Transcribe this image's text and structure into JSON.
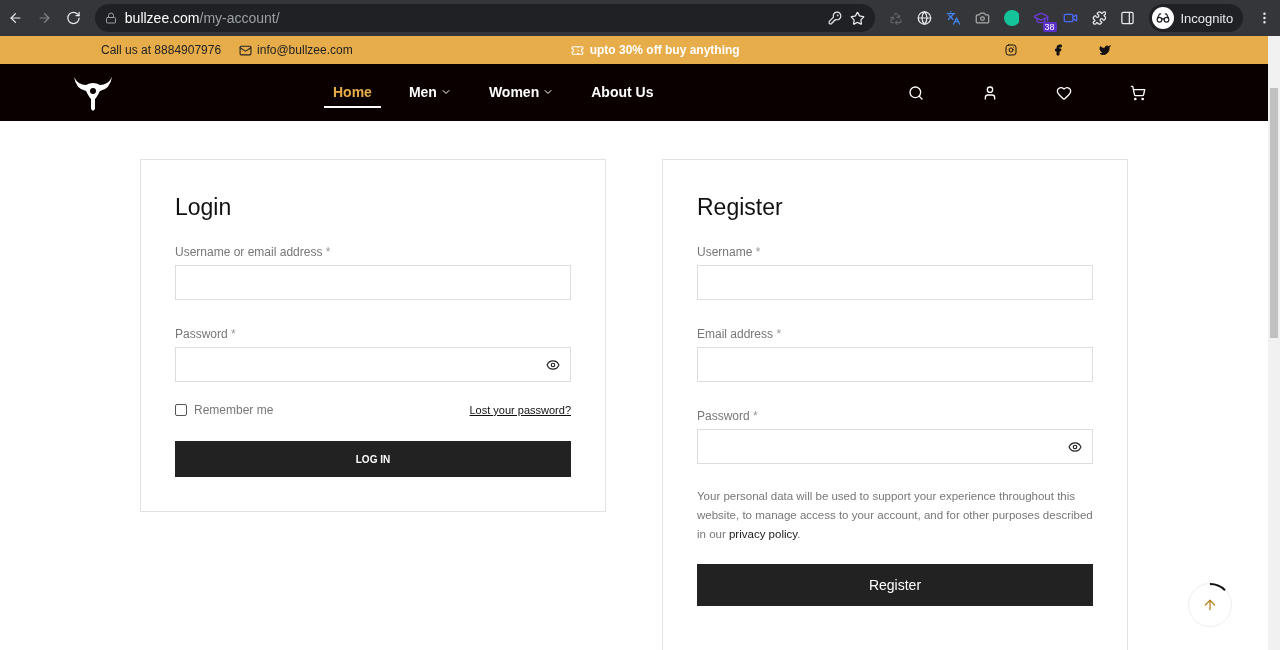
{
  "browser": {
    "url_host": "bullzee.com",
    "url_path": "/my-account/",
    "extension_badge": "38",
    "profile_label": "Incognito"
  },
  "topbar": {
    "phone": "Call us at 8884907976",
    "email": "info@bullzee.com",
    "promo": "upto 30% off buy anything"
  },
  "nav": {
    "items": [
      {
        "label": "Home",
        "selected": true,
        "has_menu": false
      },
      {
        "label": "Men",
        "selected": false,
        "has_menu": true
      },
      {
        "label": "Women",
        "selected": false,
        "has_menu": true
      },
      {
        "label": "About Us",
        "selected": false,
        "has_menu": false
      }
    ]
  },
  "login": {
    "title": "Login",
    "fields": [
      {
        "label": "Username or email address",
        "required": "*",
        "kind": "text"
      },
      {
        "label": "Password",
        "required": "*",
        "kind": "password"
      }
    ],
    "remember": {
      "label": "Remember me",
      "checked": false
    },
    "lost_password": "Lost your password?",
    "button": "LOG IN"
  },
  "register": {
    "title": "Register",
    "fields": [
      {
        "label": "Username",
        "required": "*",
        "kind": "text"
      },
      {
        "label": "Email address",
        "required": "*",
        "kind": "text"
      },
      {
        "label": "Password",
        "required": "*",
        "kind": "password"
      }
    ],
    "privacy_text": "Your personal data will be used to support your experience throughout this website, to manage access to your account, and for other purposes described in our ",
    "privacy_link": "privacy policy",
    "privacy_end": ".",
    "button": "Register"
  }
}
